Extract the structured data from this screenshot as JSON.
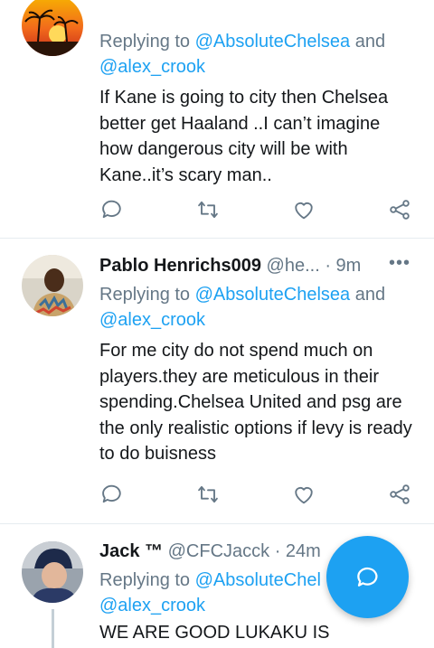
{
  "tweets": [
    {
      "display_name": "",
      "handle_time": "",
      "replying_prefix": "Replying to ",
      "mention_1": "@AbsoluteChelsea",
      "and_word": " and",
      "mention_2": "@alex_crook",
      "text": "If Kane is going to city then Chelsea better get Haaland ..I can’t imagine how dangerous city will be with Kane..it’s scary man.."
    },
    {
      "display_name": "Pablo Henrichs009",
      "handle": "@he...",
      "time": "· 9m",
      "more": "•••",
      "replying_prefix": "Replying to ",
      "mention_1": "@AbsoluteChelsea",
      "and_word": " and",
      "mention_2": "@alex_crook",
      "text": "For me city do not spend much on players.they are meticulous in their spending.Chelsea United and psg are the only realistic options if levy is ready to do buisness"
    },
    {
      "display_name": "Jack ™",
      "handle": "@CFCJacck",
      "time": "· 24m",
      "replying_prefix": "Replying to ",
      "mention_1": "@AbsoluteChel",
      "mention_2": "@alex_crook",
      "text": "WE ARE GOOD LUKAKU IS"
    }
  ],
  "icons": {
    "reply": "comment-icon",
    "retweet": "retweet-icon",
    "like": "heart-icon",
    "share": "share-icon",
    "compose": "compose-reply-icon"
  },
  "colors": {
    "accent": "#1da1f2",
    "secondary_text": "#657786",
    "divider": "#e6ecf0"
  }
}
